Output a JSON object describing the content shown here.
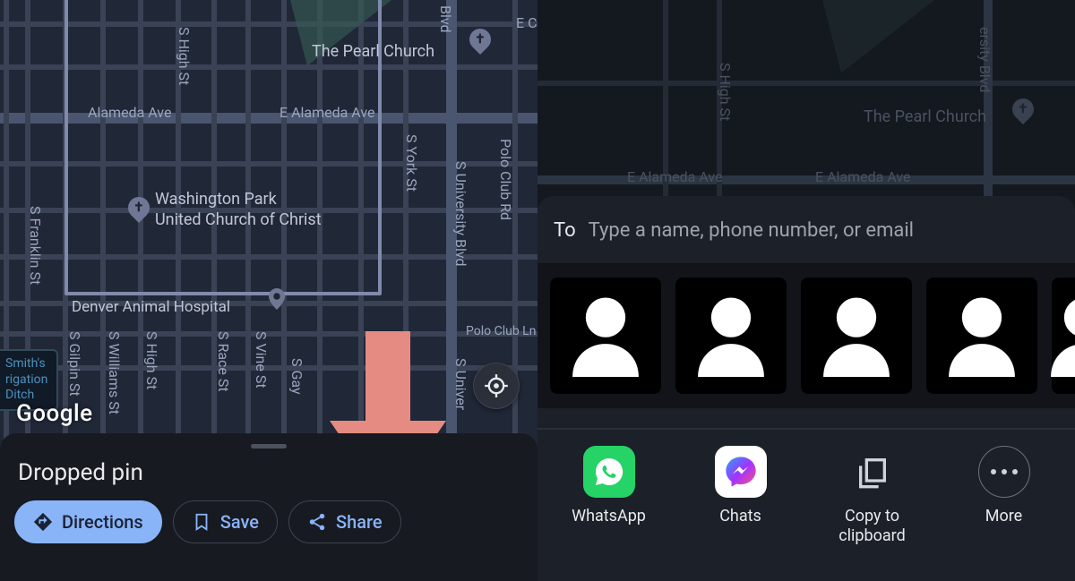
{
  "left": {
    "google_logo": "Google",
    "sheet_title": "Dropped pin",
    "chips": {
      "directions": "Directions",
      "save": "Save",
      "share": "Share"
    },
    "map_labels": {
      "alameda_w": "Alameda Ave",
      "alameda_e": "E Alameda Ave",
      "pearl_church": "The Pearl Church",
      "washington_1": "Washington Park",
      "washington_2": "United Church of Christ",
      "denver_hosp": "Denver Animal Hospital",
      "polo_club_rd": "Polo Club Rd",
      "polo_club_ln": "Polo Club Ln",
      "university": "S University Blvd",
      "s_univ_short": "S Univer",
      "franklin": "S Franklin St",
      "gilpin": "S Gilpin St",
      "williams": "S Williams St",
      "high": "S High St",
      "high2": "S High St",
      "race": "S Race St",
      "vine": "S Vine St",
      "gaylord": "S Gay",
      "york": "S York St",
      "blvd": "Blvd",
      "e_label": "E C",
      "ditch_1": "Smith's",
      "ditch_2": "rigation",
      "ditch_3": "Ditch"
    }
  },
  "right": {
    "to_label": "To",
    "to_placeholder": "Type a name, phone number, or email",
    "apps": {
      "whatsapp": "WhatsApp",
      "chats": "Chats",
      "copy": "Copy to clipboard",
      "more": "More"
    },
    "map_labels": {
      "pearl_church": "The Pearl Church",
      "alameda_e1": "E Alameda Ave",
      "alameda_e2": "E Alameda Ave",
      "high": "S High St",
      "university": "ersity Blvd"
    }
  }
}
